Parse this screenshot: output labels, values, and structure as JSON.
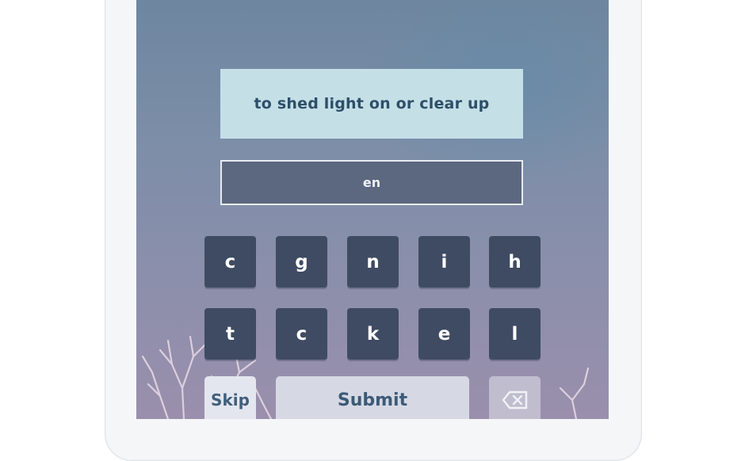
{
  "clue": {
    "text": "to shed light on or clear up"
  },
  "answer": {
    "value": "en"
  },
  "keyboard": {
    "row1": [
      "c",
      "g",
      "n",
      "i",
      "h"
    ],
    "row2": [
      "t",
      "c",
      "k",
      "e",
      "l"
    ]
  },
  "actions": {
    "skip_label": "Skip",
    "submit_label": "Submit",
    "delete_icon": "backspace-icon"
  },
  "colors": {
    "key_bg": "#3f4b63",
    "clue_bg": "#c5dfe7",
    "answer_bg": "#5c6780",
    "screen_top": "#6e86a0",
    "screen_bottom": "#9a8fac"
  }
}
